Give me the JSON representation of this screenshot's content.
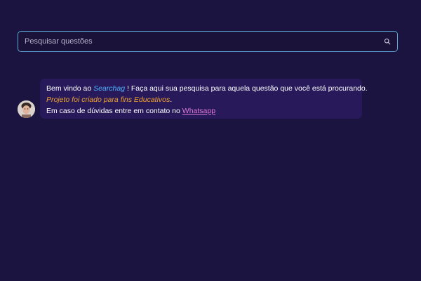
{
  "search": {
    "placeholder": "Pesquisar questões",
    "value": ""
  },
  "message": {
    "line1_prefix": "Bem vindo ao ",
    "brand_name": "Searchag",
    "line1_suffix": " ! Faça aqui sua pesquisa para aquela questão que você está procurando.",
    "line2_italic": "Projeto foi criado para fins Educativos",
    "line2_suffix": ".",
    "line3_prefix": "Em caso de dúvidas entre em contato no ",
    "link_label": "Whatsapp"
  },
  "colors": {
    "background": "#1c1440",
    "bubble": "#27195a",
    "search_border": "#5aa9d6",
    "brand": "#4fb4ff",
    "highlight": "#f0a22e",
    "link": "#e07ad8"
  },
  "icons": {
    "search": "search-icon",
    "avatar": "avatar"
  }
}
